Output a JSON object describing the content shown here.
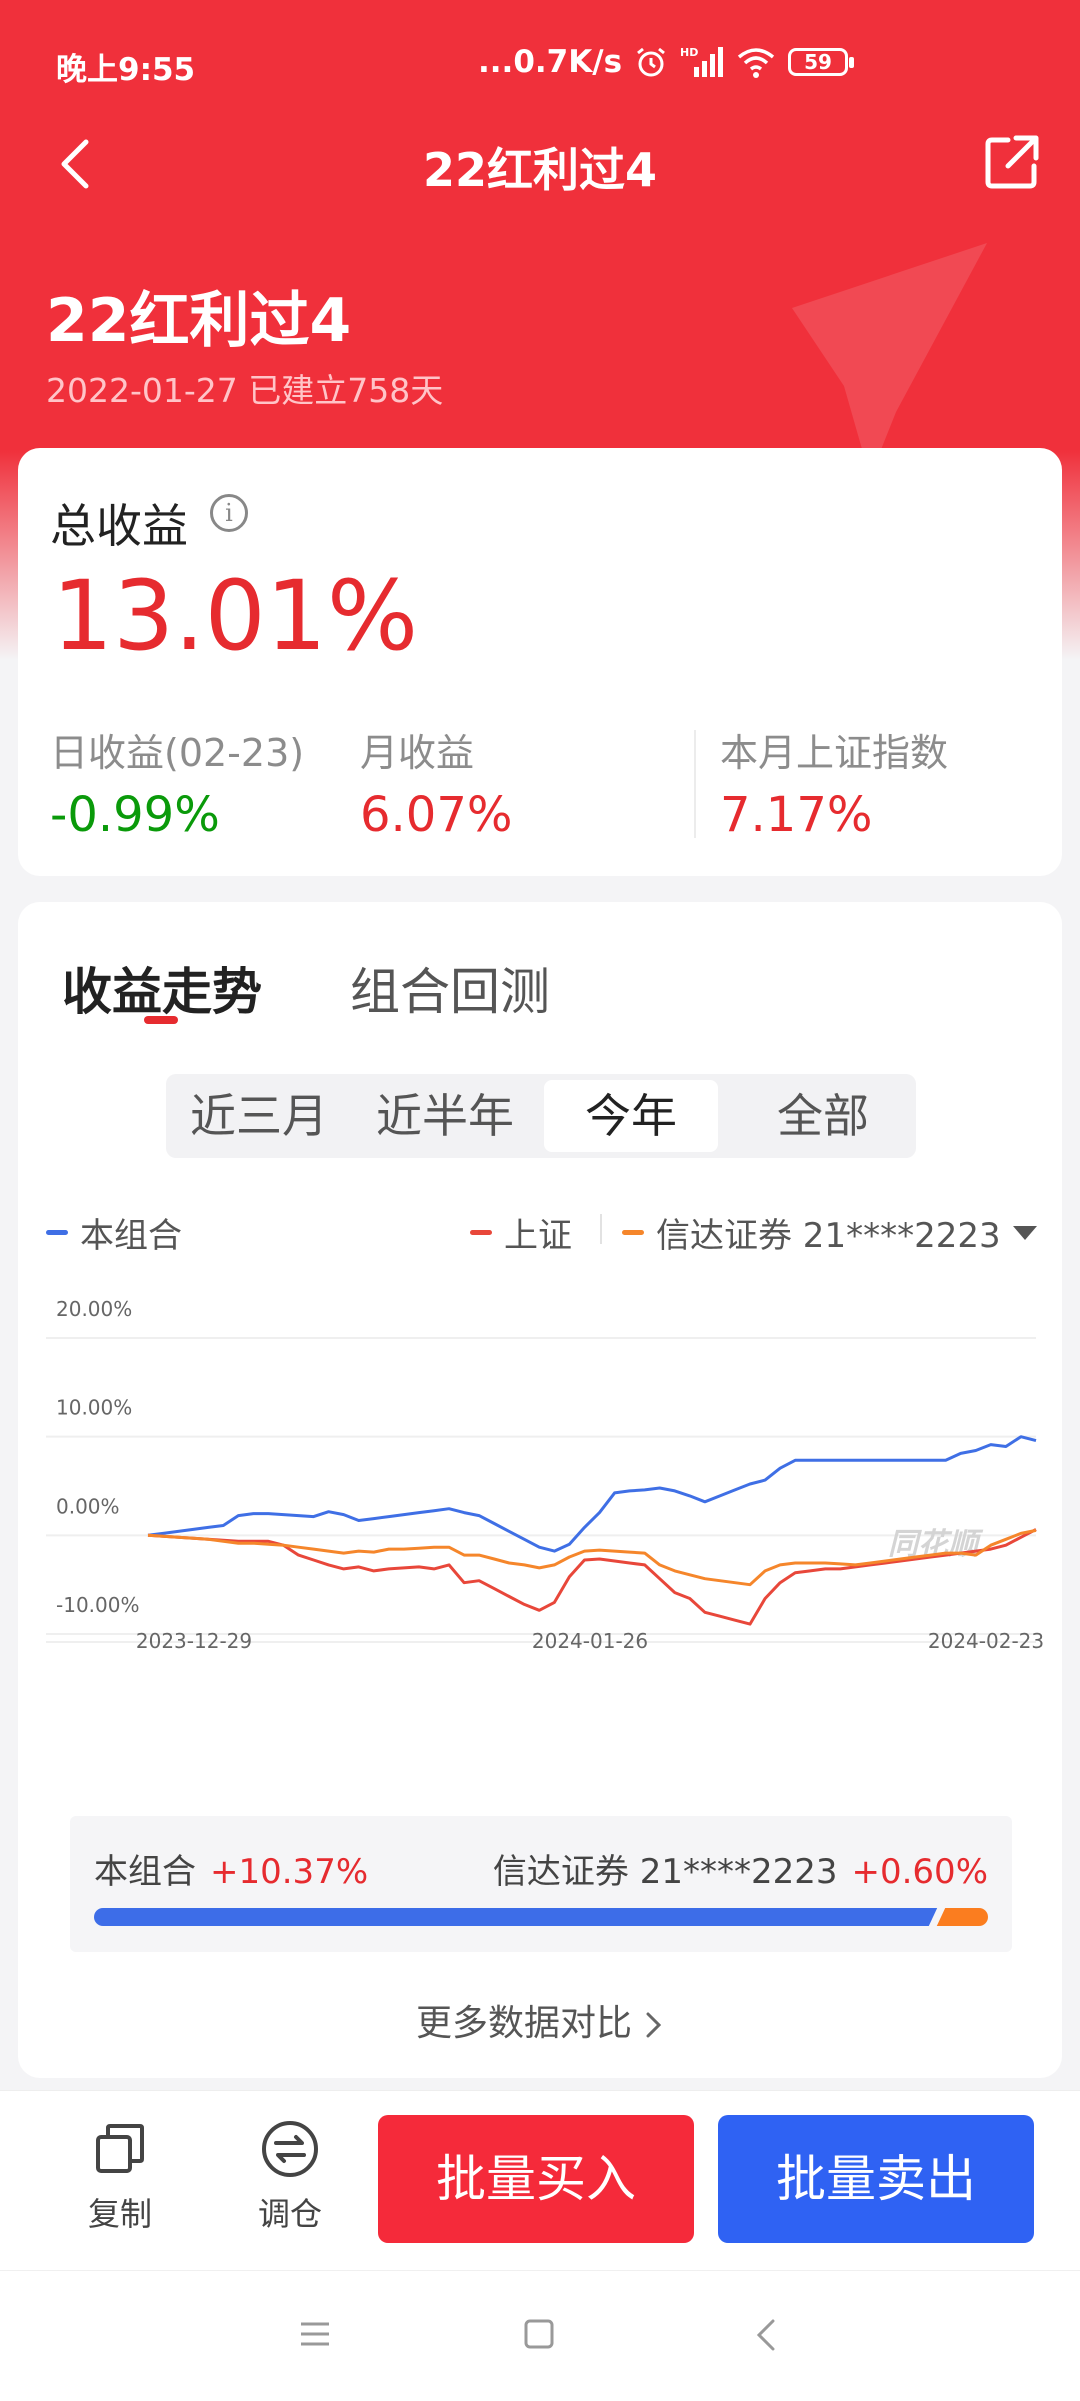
{
  "status_bar": {
    "time": "晚上9:55",
    "network_speed": "...0.7K/s",
    "battery": "59",
    "icons": [
      "alarm-icon",
      "hd-signal-icon",
      "wifi-icon",
      "battery-icon"
    ]
  },
  "nav": {
    "title": "22红利过4",
    "back_icon": "chevron-left-icon",
    "share_icon": "share-icon"
  },
  "portfolio": {
    "name": "22红利过4",
    "created_info": "2022-01-27 已建立758天"
  },
  "summary": {
    "total_label": "总收益",
    "total_value": "13.01%",
    "daily_label": "日收益(02-23)",
    "daily_value": "-0.99%",
    "monthly_label": "月收益",
    "monthly_value": "6.07%",
    "index_label": "本月上证指数",
    "index_value": "7.17%",
    "colors": {
      "up": "#e62b2f",
      "down": "#0a9a0a"
    }
  },
  "tabs": {
    "active": "收益走势",
    "inactive": "组合回测"
  },
  "range_selector": {
    "options": [
      "近三月",
      "近半年",
      "今年",
      "全部"
    ],
    "selected": "今年"
  },
  "legend": {
    "portfolio": "本组合",
    "shanghai": "上证",
    "broker": "信达证券 21****2223"
  },
  "watermark": "同花顺",
  "chart_data": {
    "type": "line",
    "y_ticks": [
      "20.00%",
      "10.00%",
      "0.00%",
      "-10.00%"
    ],
    "x_ticks": [
      "2023-12-29",
      "2024-01-26",
      "2024-02-23"
    ],
    "ylim": [
      -10,
      20
    ],
    "series": [
      {
        "name": "本组合",
        "color": "#3f6fe5",
        "values": [
          0,
          0.2,
          0.4,
          0.6,
          0.8,
          1.0,
          2.0,
          2.2,
          2.2,
          2.1,
          2.0,
          1.9,
          2.4,
          2.1,
          1.5,
          1.7,
          1.9,
          2.1,
          2.3,
          2.5,
          2.7,
          2.3,
          2.0,
          1.2,
          0.4,
          -0.4,
          -1.2,
          -1.6,
          -0.9,
          0.8,
          2.3,
          4.3,
          4.5,
          4.6,
          4.8,
          4.5,
          4.0,
          3.4,
          4.0,
          4.6,
          5.2,
          5.6,
          6.8,
          7.6,
          7.6,
          7.6,
          7.6,
          7.6,
          7.6,
          7.6,
          7.6,
          7.6,
          7.6,
          7.6,
          8.3,
          8.6,
          9.2,
          9.0,
          10.0,
          9.6
        ]
      },
      {
        "name": "上证",
        "color": "#e8473a",
        "values": [
          0,
          -0.1,
          -0.2,
          -0.3,
          -0.4,
          -0.5,
          -0.6,
          -0.6,
          -0.6,
          -1.0,
          -2.0,
          -2.5,
          -3.0,
          -3.4,
          -3.2,
          -3.6,
          -3.4,
          -3.3,
          -3.2,
          -3.4,
          -3.0,
          -4.8,
          -4.6,
          -5.4,
          -6.2,
          -7.0,
          -7.6,
          -6.8,
          -4.2,
          -2.5,
          -2.4,
          -2.6,
          -2.8,
          -3.0,
          -4.4,
          -5.8,
          -6.4,
          -7.8,
          -8.2,
          -8.6,
          -9.0,
          -6.4,
          -4.8,
          -3.8,
          -3.6,
          -3.4,
          -3.4,
          -3.2,
          -3.0,
          -2.8,
          -2.6,
          -2.4,
          -2.2,
          -2.0,
          -1.8,
          -1.6,
          -1.4,
          -1.0,
          -0.2,
          0.6
        ]
      },
      {
        "name": "信达证券 21****2223",
        "color": "#f5862b",
        "values": [
          0,
          -0.1,
          -0.2,
          -0.3,
          -0.4,
          -0.6,
          -0.8,
          -0.8,
          -0.9,
          -1.0,
          -1.2,
          -1.4,
          -1.6,
          -1.8,
          -1.6,
          -1.7,
          -1.4,
          -1.4,
          -1.3,
          -1.2,
          -1.2,
          -2.0,
          -2.0,
          -2.4,
          -2.8,
          -3.0,
          -3.3,
          -3.0,
          -2.2,
          -1.6,
          -1.5,
          -1.6,
          -1.7,
          -1.8,
          -3.0,
          -3.6,
          -4.0,
          -4.4,
          -4.6,
          -4.8,
          -5.0,
          -3.6,
          -3.0,
          -2.8,
          -2.8,
          -2.8,
          -2.9,
          -3.0,
          -2.8,
          -2.6,
          -2.4,
          -2.2,
          -2.0,
          -1.8,
          -1.8,
          -2.0,
          -1.0,
          -0.4,
          0.2,
          0.5
        ]
      }
    ]
  },
  "comparison": {
    "portfolio_label": "本组合",
    "portfolio_value": "+10.37%",
    "broker_label": "信达证券 21****2223",
    "broker_value": "+0.60%",
    "portfolio_share": 0.943
  },
  "more_compare": "更多数据对比",
  "bottom_actions": {
    "copy": "复制",
    "rebalance": "调仓",
    "buy": "批量买入",
    "sell": "批量卖出"
  }
}
